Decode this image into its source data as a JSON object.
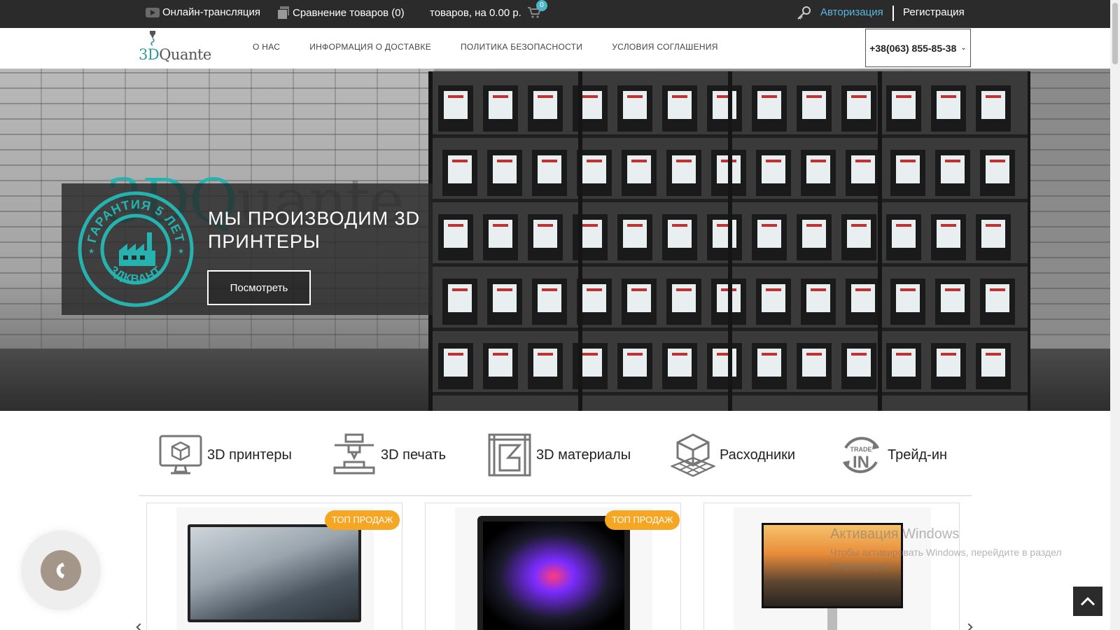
{
  "topbar": {
    "live_label": "Онлайн-трансляция",
    "compare_label": "Сравнение товаров (0)",
    "cart_label": "товаров, на 0.00 р.",
    "cart_count": "0",
    "login_label": "Авторизация",
    "register_label": "Регистрация"
  },
  "header": {
    "logo_prefix": "3D",
    "logo_suffix": "Quante",
    "nav": [
      "О НАС",
      "ИНФОРМАЦИЯ О ДОСТАВКЕ",
      "ПОЛИТИКА БЕЗОПАСНОСТИ",
      "УСЛОВИЯ СОГЛАШЕНИЯ"
    ],
    "phone": "+38(063) 855-85-38"
  },
  "hero": {
    "brand_prefix": "3DQ",
    "brand_suffix": "uante",
    "badge_top": "ГАРАНТИЯ 5 ЛЕТ",
    "badge_bottom": "3ДКВАНТ",
    "title": "МЫ ПРОИЗВОДИМ 3D ПРИНТЕРЫ",
    "button_label": "Посмотреть"
  },
  "categories": [
    {
      "label": "3D принтеры",
      "icon": "monitor-cube-icon"
    },
    {
      "label": "3D печать",
      "icon": "print-head-icon"
    },
    {
      "label": "3D материалы",
      "icon": "material-frame-icon"
    },
    {
      "label": "Расходники",
      "icon": "cube-grid-icon"
    },
    {
      "label": "Трейд-ин",
      "icon": "trade-in-icon"
    }
  ],
  "products": [
    {
      "badge": "ТОП ПРОДАЖ",
      "kind": "tv"
    },
    {
      "badge": "ТОП ПРОДАЖ",
      "kind": "laptop"
    },
    {
      "badge": "",
      "kind": "monitor"
    }
  ],
  "watermark": {
    "line1": "Активация Windows",
    "line2": "Чтобы активировать Windows, перейдите в раздел",
    "line3": "\"Параметры\"."
  },
  "colors": {
    "accent": "#26b3b0",
    "topbar": "#2b2b2b",
    "link": "#5ab8e0",
    "hot_badge": "#f5a623",
    "callback": "#a4978a"
  }
}
